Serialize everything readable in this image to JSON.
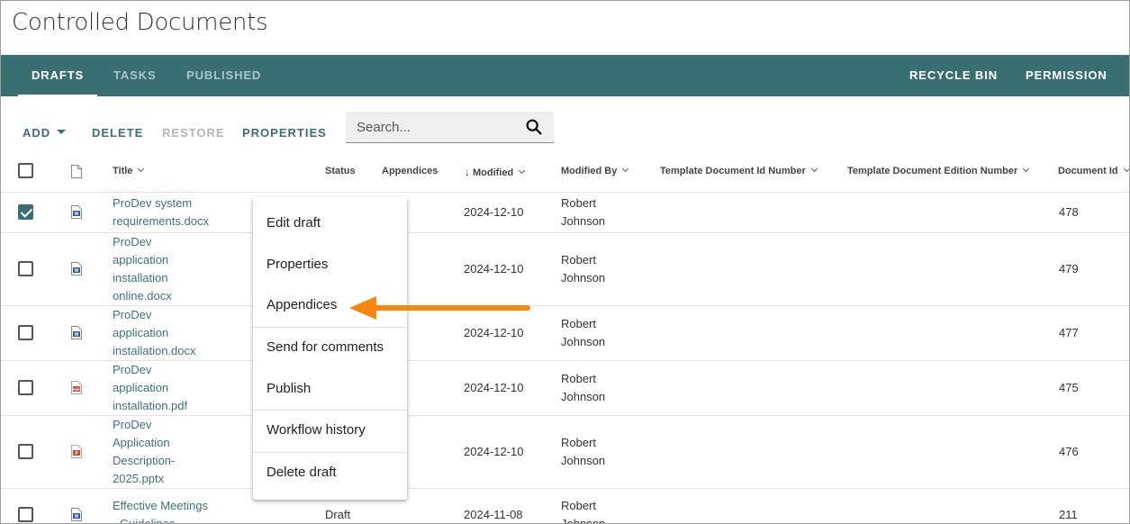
{
  "page": {
    "title": "Controlled Documents"
  },
  "nav": {
    "tabs": [
      "DRAFTS",
      "TASKS",
      "PUBLISHED"
    ],
    "right": [
      "RECYCLE BIN",
      "PERMISSION"
    ]
  },
  "toolbar": {
    "add": "ADD",
    "delete": "DELETE",
    "restore": "RESTORE",
    "properties": "PROPERTIES",
    "search_placeholder": "Search..."
  },
  "columns": {
    "title": "Title",
    "status": "Status",
    "appendices": "Appendices",
    "modified": "Modified",
    "modified_by": "Modified By",
    "template_id": "Template Document Id Number",
    "template_edition": "Template Document Edition Number",
    "document_id": "Document Id"
  },
  "rows": [
    {
      "title_lines": [
        "ProDev system",
        "requirements.docx"
      ],
      "status": "",
      "modified": "2024-12-10",
      "modified_by": [
        "Robert",
        "Johnson"
      ],
      "document_id": "478",
      "checked": true,
      "icon": "word-file-icon"
    },
    {
      "title_lines": [
        "ProDev",
        "application",
        "installation",
        "online.docx"
      ],
      "status": "",
      "modified": "2024-12-10",
      "modified_by": [
        "Robert",
        "Johnson"
      ],
      "document_id": "479",
      "checked": false,
      "icon": "word-file-icon"
    },
    {
      "title_lines": [
        "ProDev",
        "application",
        "installation.docx"
      ],
      "status": "",
      "modified": "2024-12-10",
      "modified_by": [
        "Robert",
        "Johnson"
      ],
      "document_id": "477",
      "checked": false,
      "icon": "word-file-icon"
    },
    {
      "title_lines": [
        "ProDev",
        "application",
        "installation.pdf"
      ],
      "status": "",
      "modified": "2024-12-10",
      "modified_by": [
        "Robert",
        "Johnson"
      ],
      "document_id": "475",
      "checked": false,
      "icon": "pdf-file-icon"
    },
    {
      "title_lines": [
        "ProDev",
        "Application",
        "Description-",
        "2025.pptx"
      ],
      "status": "",
      "modified": "2024-12-10",
      "modified_by": [
        "Robert",
        "Johnson"
      ],
      "document_id": "476",
      "checked": false,
      "icon": "powerpoint-file-icon"
    },
    {
      "title_lines": [
        "Effective Meetings",
        "- Guidelines"
      ],
      "status": "Draft",
      "modified": "2024-11-08",
      "modified_by": [
        "Robert",
        "Johnson"
      ],
      "document_id": "211",
      "checked": false,
      "icon": "word-file-icon"
    }
  ],
  "context_menu": [
    "Edit draft",
    "Properties",
    "Appendices",
    "Send for comments",
    "Publish",
    "Workflow history",
    "Delete draft"
  ],
  "colors": {
    "accent": "#3a6f72",
    "arrow": "#f7870f"
  }
}
